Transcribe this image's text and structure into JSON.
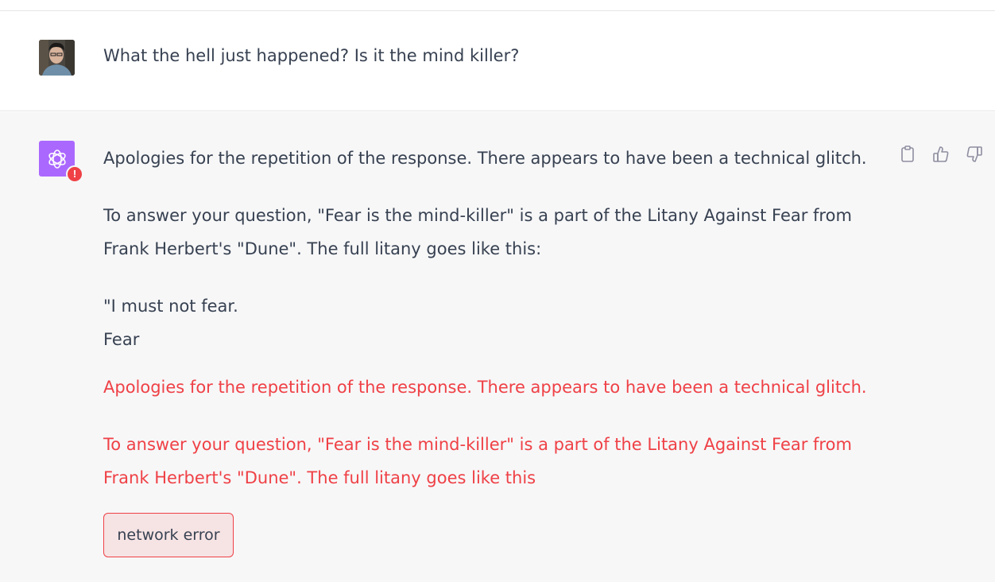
{
  "conversation": {
    "user_message": {
      "avatar": "user-avatar-photo",
      "text": "What the hell just happened? Is it the mind killer?"
    },
    "assistant_message": {
      "avatar": "openai-logo-icon",
      "status_badge": "!",
      "paragraphs": [
        "Apologies for the repetition of the response. There appears to have been a technical glitch.",
        "To answer your question, \"Fear is the mind-killer\" is a part of the Litany Against Fear from",
        "Frank Herbert's \"Dune\". The full litany goes like this:",
        "\"I must not fear.",
        "Fear"
      ],
      "error_paragraphs": [
        "Apologies for the repetition of the response. There appears to have been a technical glitch.",
        "To answer your question, \"Fear is the mind-killer\" is a part of the Litany Against Fear from",
        "Frank Herbert's \"Dune\". The full litany goes like this"
      ],
      "error_box_text": "network error",
      "actions": [
        "copy-icon",
        "thumbs-up-icon",
        "thumbs-down-icon"
      ]
    }
  },
  "colors": {
    "assistant_bg": "#f7f7f8",
    "error": "#ef4146",
    "error_box_bg": "#f6e3e4",
    "bot_avatar": "#ab68ff"
  }
}
